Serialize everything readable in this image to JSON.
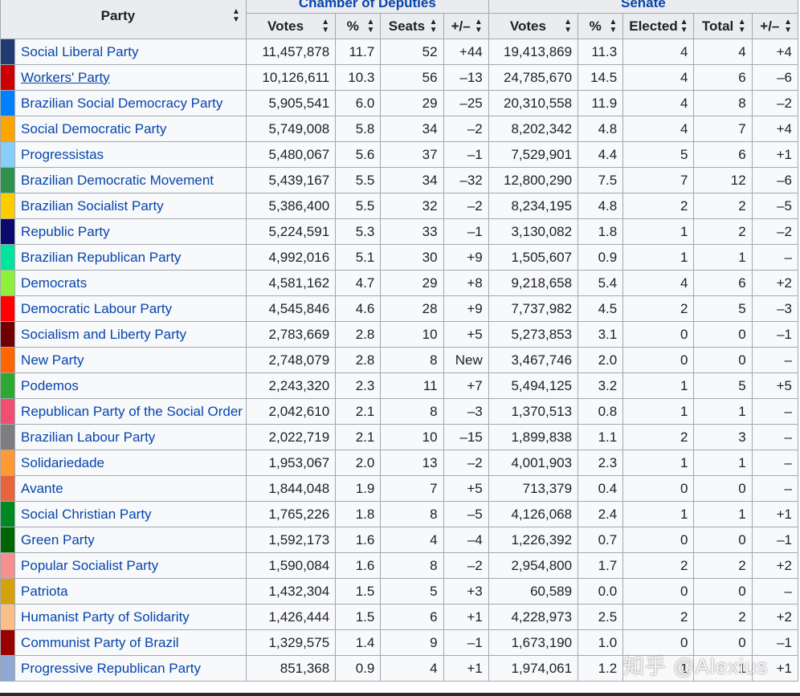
{
  "headers": {
    "party": "Party",
    "chamber": "Chamber of Deputies",
    "senate": "Senate",
    "votes": "Votes",
    "pct": "%",
    "seats": "Seats",
    "pm": "+/–",
    "s_votes": "Votes",
    "s_pct": "%",
    "elected": "Elected",
    "total": "Total",
    "s_pm": "+/–"
  },
  "sort_icon": "sort-arrows-icon",
  "rows": [
    {
      "color": "#213a73",
      "party": "Social Liberal Party",
      "votes": "11,457,878",
      "pct": "11.7",
      "seats": "52",
      "pm": "+44",
      "s_votes": "19,413,869",
      "s_pct": "11.3",
      "elected": "4",
      "total": "4",
      "s_pm": "+4"
    },
    {
      "color": "#cc0000",
      "party": "Workers' Party",
      "underline": true,
      "votes": "10,126,611",
      "pct": "10.3",
      "seats": "56",
      "pm": "–13",
      "s_votes": "24,785,670",
      "s_pct": "14.5",
      "elected": "4",
      "total": "6",
      "s_pm": "–6"
    },
    {
      "color": "#0080ff",
      "party": "Brazilian Social Democracy Party",
      "votes": "5,905,541",
      "pct": "6.0",
      "seats": "29",
      "pm": "–25",
      "s_votes": "20,310,558",
      "s_pct": "11.9",
      "elected": "4",
      "total": "8",
      "s_pm": "–2"
    },
    {
      "color": "#ffa500",
      "party": "Social Democratic Party",
      "votes": "5,749,008",
      "pct": "5.8",
      "seats": "34",
      "pm": "–2",
      "s_votes": "8,202,342",
      "s_pct": "4.8",
      "elected": "4",
      "total": "7",
      "s_pm": "+4"
    },
    {
      "color": "#87cefa",
      "party": "Progressistas",
      "votes": "5,480,067",
      "pct": "5.6",
      "seats": "37",
      "pm": "–1",
      "s_votes": "7,529,901",
      "s_pct": "4.4",
      "elected": "5",
      "total": "6",
      "s_pm": "+1"
    },
    {
      "color": "#30914d",
      "party": "Brazilian Democratic Movement",
      "votes": "5,439,167",
      "pct": "5.5",
      "seats": "34",
      "pm": "–32",
      "s_votes": "12,800,290",
      "s_pct": "7.5",
      "elected": "7",
      "total": "12",
      "s_pm": "–6"
    },
    {
      "color": "#ffcc00",
      "party": "Brazilian Socialist Party",
      "votes": "5,386,400",
      "pct": "5.5",
      "seats": "32",
      "pm": "–2",
      "s_votes": "8,234,195",
      "s_pct": "4.8",
      "elected": "2",
      "total": "2",
      "s_pm": "–5"
    },
    {
      "color": "#0a0a6e",
      "party": "Republic Party",
      "votes": "5,224,591",
      "pct": "5.3",
      "seats": "33",
      "pm": "–1",
      "s_votes": "3,130,082",
      "s_pct": "1.8",
      "elected": "1",
      "total": "2",
      "s_pm": "–2"
    },
    {
      "color": "#00e4a0",
      "party": "Brazilian Republican Party",
      "votes": "4,992,016",
      "pct": "5.1",
      "seats": "30",
      "pm": "+9",
      "s_votes": "1,505,607",
      "s_pct": "0.9",
      "elected": "1",
      "total": "1",
      "s_pm": "–"
    },
    {
      "color": "#8cf03c",
      "party": "Democrats",
      "votes": "4,581,162",
      "pct": "4.7",
      "seats": "29",
      "pm": "+8",
      "s_votes": "9,218,658",
      "s_pct": "5.4",
      "elected": "4",
      "total": "6",
      "s_pm": "+2"
    },
    {
      "color": "#ff0000",
      "party": "Democratic Labour Party",
      "votes": "4,545,846",
      "pct": "4.6",
      "seats": "28",
      "pm": "+9",
      "s_votes": "7,737,982",
      "s_pct": "4.5",
      "elected": "2",
      "total": "5",
      "s_pm": "–3"
    },
    {
      "color": "#700000",
      "party": "Socialism and Liberty Party",
      "votes": "2,783,669",
      "pct": "2.8",
      "seats": "10",
      "pm": "+5",
      "s_votes": "5,273,853",
      "s_pct": "3.1",
      "elected": "0",
      "total": "0",
      "s_pm": "–1"
    },
    {
      "color": "#ff6600",
      "party": "New Party",
      "votes": "2,748,079",
      "pct": "2.8",
      "seats": "8",
      "pm": "New",
      "s_votes": "3,467,746",
      "s_pct": "2.0",
      "elected": "0",
      "total": "0",
      "s_pm": "–"
    },
    {
      "color": "#2da933",
      "party": "Podemos",
      "votes": "2,243,320",
      "pct": "2.3",
      "seats": "11",
      "pm": "+7",
      "s_votes": "5,494,125",
      "s_pct": "3.2",
      "elected": "1",
      "total": "5",
      "s_pm": "+5"
    },
    {
      "color": "#f0506e",
      "party": "Republican Party of the Social Order",
      "votes": "2,042,610",
      "pct": "2.1",
      "seats": "8",
      "pm": "–3",
      "s_votes": "1,370,513",
      "s_pct": "0.8",
      "elected": "1",
      "total": "1",
      "s_pm": "–"
    },
    {
      "color": "#7d7d7d",
      "party": "Brazilian Labour Party",
      "votes": "2,022,719",
      "pct": "2.1",
      "seats": "10",
      "pm": "–15",
      "s_votes": "1,899,838",
      "s_pct": "1.1",
      "elected": "2",
      "total": "3",
      "s_pm": "–"
    },
    {
      "color": "#ff9933",
      "party": "Solidariedade",
      "votes": "1,953,067",
      "pct": "2.0",
      "seats": "13",
      "pm": "–2",
      "s_votes": "4,001,903",
      "s_pct": "2.3",
      "elected": "1",
      "total": "1",
      "s_pm": "–"
    },
    {
      "color": "#e8643c",
      "party": "Avante",
      "votes": "1,844,048",
      "pct": "1.9",
      "seats": "7",
      "pm": "+5",
      "s_votes": "713,379",
      "s_pct": "0.4",
      "elected": "0",
      "total": "0",
      "s_pm": "–"
    },
    {
      "color": "#008822",
      "party": "Social Christian Party",
      "votes": "1,765,226",
      "pct": "1.8",
      "seats": "8",
      "pm": "–5",
      "s_votes": "4,126,068",
      "s_pct": "2.4",
      "elected": "1",
      "total": "1",
      "s_pm": "+1"
    },
    {
      "color": "#006400",
      "party": "Green Party",
      "votes": "1,592,173",
      "pct": "1.6",
      "seats": "4",
      "pm": "–4",
      "s_votes": "1,226,392",
      "s_pct": "0.7",
      "elected": "0",
      "total": "0",
      "s_pm": "–1"
    },
    {
      "color": "#f59090",
      "party": "Popular Socialist Party",
      "votes": "1,590,084",
      "pct": "1.6",
      "seats": "8",
      "pm": "–2",
      "s_votes": "2,954,800",
      "s_pct": "1.7",
      "elected": "2",
      "total": "2",
      "s_pm": "+2"
    },
    {
      "color": "#d4a20a",
      "party": "Patriota",
      "votes": "1,432,304",
      "pct": "1.5",
      "seats": "5",
      "pm": "+3",
      "s_votes": "60,589",
      "s_pct": "0.0",
      "elected": "0",
      "total": "0",
      "s_pm": "–"
    },
    {
      "color": "#fbbf8a",
      "party": "Humanist Party of Solidarity",
      "votes": "1,426,444",
      "pct": "1.5",
      "seats": "6",
      "pm": "+1",
      "s_votes": "4,228,973",
      "s_pct": "2.5",
      "elected": "2",
      "total": "2",
      "s_pm": "+2"
    },
    {
      "color": "#990000",
      "party": "Communist Party of Brazil",
      "votes": "1,329,575",
      "pct": "1.4",
      "seats": "9",
      "pm": "–1",
      "s_votes": "1,673,190",
      "s_pct": "1.0",
      "elected": "0",
      "total": "0",
      "s_pm": "–1"
    },
    {
      "color": "#8fa8d4",
      "party": "Progressive Republican Party",
      "votes": "851,368",
      "pct": "0.9",
      "seats": "4",
      "pm": "+1",
      "s_votes": "1,974,061",
      "s_pct": "1.2",
      "elected": "1",
      "total": "1",
      "s_pm": "+1"
    }
  ],
  "watermark": "知乎 @Alexius"
}
